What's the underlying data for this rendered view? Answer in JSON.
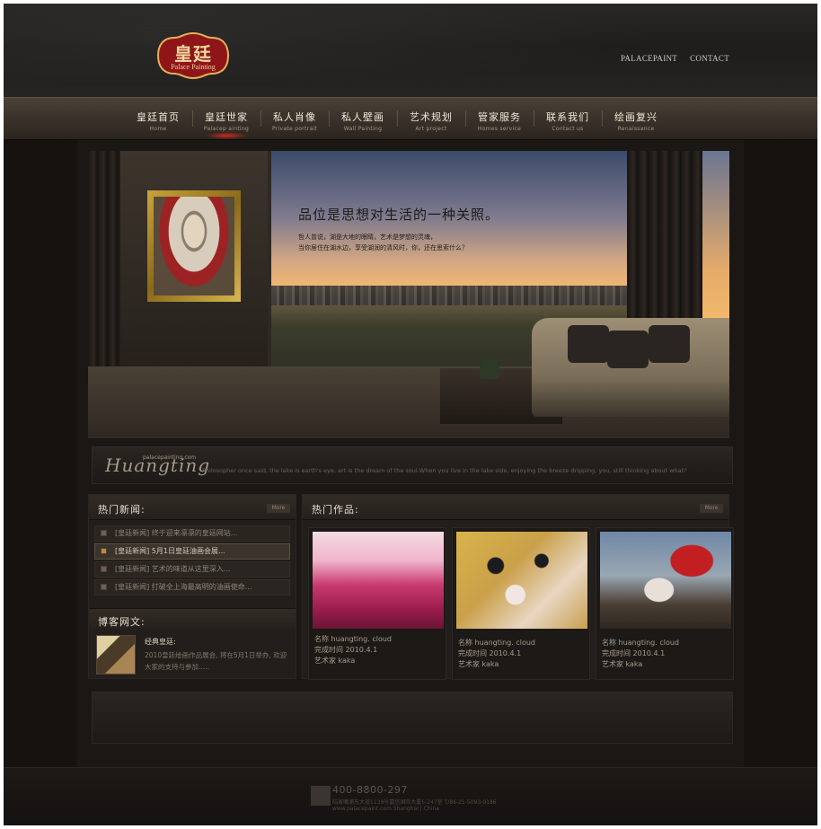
{
  "header": {
    "logo_cn": "皇廷",
    "logo_en": "Palace Painting",
    "top_links": [
      "PALACEPAINT",
      "CONTACT"
    ]
  },
  "nav": {
    "items": [
      {
        "cn": "皇廷首页",
        "en": "Home"
      },
      {
        "cn": "皇廷世家",
        "en": "Palacep ainting"
      },
      {
        "cn": "私人肖像",
        "en": "Private portrait"
      },
      {
        "cn": "私人壁画",
        "en": "Wall Painting"
      },
      {
        "cn": "艺术规划",
        "en": "Art project"
      },
      {
        "cn": "管家服务",
        "en": "Homes service"
      },
      {
        "cn": "联系我们",
        "en": "Contact us"
      },
      {
        "cn": "绘画复兴",
        "en": "Renaissance"
      }
    ],
    "active_index": 1
  },
  "hero": {
    "title": "品位是思想对生活的一种关照。",
    "line1": "哲人曾说，湖是大地的眼睛，艺术是梦想的灵魂，",
    "line2": "当你居住在湖水边，享受湖润的清风时，你，还在思索什么？"
  },
  "banner": {
    "script": "Huangting",
    "url": "palacepainting.com",
    "text": "Philosopher once said, the lake is earth's eye, art is the dream of the soul.When you live in the lake side, enjoying the breeze dripping, you, still thinking about what?"
  },
  "news": {
    "title": "热门新闻:",
    "more": "More",
    "items": [
      {
        "text": "[皇廷新闻]   终于迎来凛凛的皇廷网站..."
      },
      {
        "text": "[皇廷新闻]   5月1日皇廷油画会展..."
      },
      {
        "text": "[皇廷新闻]   艺术的味道从这里深入..."
      },
      {
        "text": "[皇廷新闻]   打破全上海最高明的油画使命..."
      }
    ],
    "active_index": 1
  },
  "blog": {
    "title": "博客网文:",
    "post_title": "经典皇廷:",
    "post_text": "2010皇廷绘画作品展会, 将在5月1日举办, 欢迎大家的支持与参加....."
  },
  "works": {
    "title": "热门作品:",
    "more": "More",
    "items": [
      {
        "name": "名称 huangting. cloud",
        "date": "完成时间 2010.4.1",
        "artist": "艺术家 kaka"
      },
      {
        "name": "名称 huangting. cloud",
        "date": "完成时间 2010.4.1",
        "artist": "艺术家 kaka"
      },
      {
        "name": "名称 huangting. cloud",
        "date": "完成时间 2010.4.1",
        "artist": "艺术家 kaka"
      }
    ]
  },
  "footer": {
    "phone": "400-8800-297",
    "address": "陆家嘴浦东大道1139号嘉信国际大厦5-247室 T/86-21-5093-9186",
    "copyright": "www.palacepaint.com Shanghai | China"
  },
  "colors": {
    "background": "#151210",
    "accent_red": "#c21f22",
    "text_light": "#e8dfd0"
  }
}
